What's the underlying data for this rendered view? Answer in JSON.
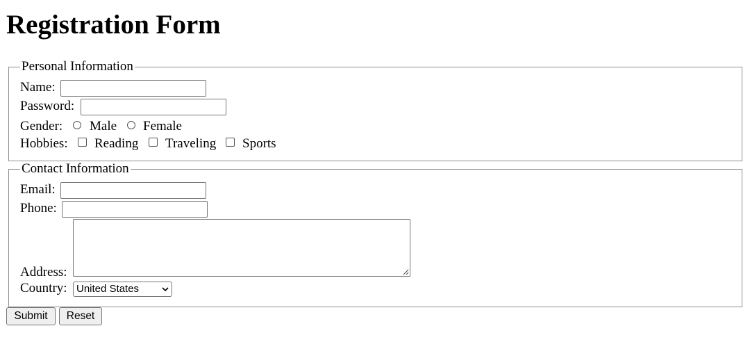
{
  "page": {
    "title": "Registration Form"
  },
  "personal": {
    "legend": "Personal Information",
    "name_label": "Name:",
    "name_value": "",
    "password_label": "Password:",
    "password_value": "",
    "gender_label": "Gender:",
    "gender_options": [
      "Male",
      "Female"
    ],
    "hobbies_label": "Hobbies:",
    "hobby_options": [
      "Reading",
      "Traveling",
      "Sports"
    ]
  },
  "contact": {
    "legend": "Contact Information",
    "email_label": "Email:",
    "email_value": "",
    "phone_label": "Phone:",
    "phone_value": "",
    "address_label": "Address:",
    "address_value": "",
    "country_label": "Country:",
    "country_selected": "United States"
  },
  "actions": {
    "submit_label": "Submit",
    "reset_label": "Reset"
  },
  "icons": {
    "select_caret": "chevron-down-icon",
    "textarea_grip": "resize-grip-icon"
  }
}
